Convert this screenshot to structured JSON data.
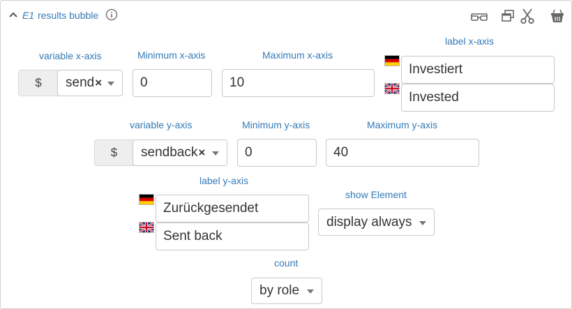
{
  "header": {
    "element_id": "E1",
    "title": "results bubble",
    "info_icon": "info-circle-icon",
    "tools": [
      "glasses-icon",
      "copy-icon",
      "scissors-icon",
      "trash-basket-icon"
    ]
  },
  "x_axis": {
    "variable_label": "variable x-axis",
    "variable_prefix": "$",
    "variable_value": "send",
    "clear_glyph": "×",
    "min_label": "Minimum x-axis",
    "min_value": "0",
    "max_label": "Maximum x-axis",
    "max_value": "10",
    "axis_label_heading": "label x-axis",
    "label_de": "Investiert",
    "label_en": "Invested"
  },
  "y_axis": {
    "variable_label": "variable y-axis",
    "variable_prefix": "$",
    "variable_value": "sendback",
    "clear_glyph": "×",
    "min_label": "Minimum y-axis",
    "min_value": "0",
    "max_label": "Maximum y-axis",
    "max_value": "40",
    "axis_label_heading": "label y-axis",
    "label_de": "Zurückgesendet",
    "label_en": "Sent back"
  },
  "show_element": {
    "label": "show Element",
    "value": "display always"
  },
  "count": {
    "label": "count",
    "value": "by role"
  },
  "colors": {
    "label_blue": "#337ab7",
    "border": "#c8c8c8",
    "addon_bg": "#eeeeee"
  }
}
